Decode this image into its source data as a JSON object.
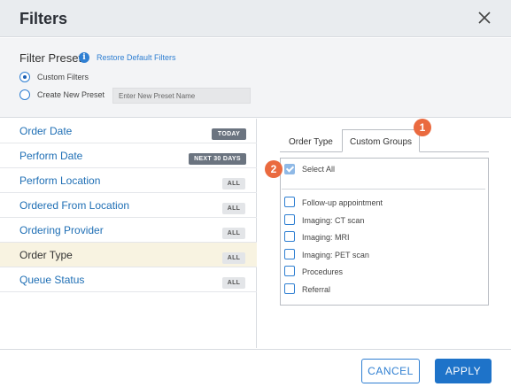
{
  "dialog": {
    "title": "Filters"
  },
  "presets": {
    "heading": "Filter Presets",
    "info_icon_glyph": "i",
    "restore_link": "Restore Default Filters",
    "options": [
      {
        "label": "Custom Filters",
        "selected": true
      },
      {
        "label": "Create New Preset",
        "selected": false
      }
    ],
    "new_preset_placeholder": "Enter New Preset Name"
  },
  "filters": [
    {
      "label": "Order Date",
      "badge": "TODAY",
      "badge_style": "dark",
      "selected": false
    },
    {
      "label": "Perform Date",
      "badge": "NEXT 30 DAYS",
      "badge_style": "dark",
      "selected": false
    },
    {
      "label": "Perform Location",
      "badge": "ALL",
      "badge_style": "light",
      "selected": false
    },
    {
      "label": "Ordered From Location",
      "badge": "ALL",
      "badge_style": "light",
      "selected": false
    },
    {
      "label": "Ordering Provider",
      "badge": "ALL",
      "badge_style": "light",
      "selected": false
    },
    {
      "label": "Order Type",
      "badge": "ALL",
      "badge_style": "light",
      "selected": true
    },
    {
      "label": "Queue Status",
      "badge": "ALL",
      "badge_style": "light",
      "selected": false
    }
  ],
  "tabs": [
    {
      "label": "Order Type",
      "active": false
    },
    {
      "label": "Custom Groups",
      "active": true
    }
  ],
  "custom_groups": {
    "select_all": {
      "label": "Select All",
      "checked": true
    },
    "items": [
      {
        "label": "Follow-up appointment",
        "checked": false
      },
      {
        "label": "Imaging: CT scan",
        "checked": false
      },
      {
        "label": "Imaging: MRI",
        "checked": false
      },
      {
        "label": "Imaging: PET scan",
        "checked": false
      },
      {
        "label": "Procedures",
        "checked": false
      },
      {
        "label": "Referral",
        "checked": false
      }
    ]
  },
  "callouts": [
    "1",
    "2"
  ],
  "footer": {
    "cancel_label": "CANCEL",
    "apply_label": "APPLY"
  },
  "colors": {
    "accent": "#1e73c9",
    "link": "#1f6fb5",
    "callout": "#ea6a3f",
    "selected_row": "#f8f3e1",
    "header_bg": "#e9ecef"
  }
}
